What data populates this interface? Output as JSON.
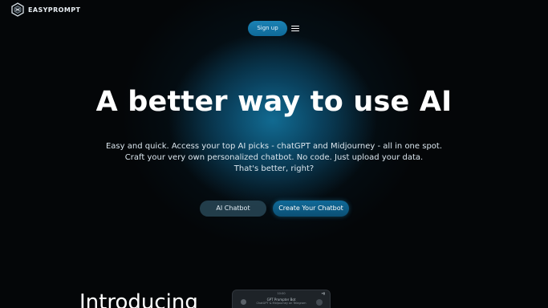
{
  "header": {
    "logo_text": "EASYPROMPT",
    "signup_label": "Sign up",
    "menu_icon": "hamburger-menu-icon"
  },
  "hero": {
    "title": "A better way to use AI",
    "subtitle_lines": [
      "Easy and quick. Access your top AI picks - chatGPT and Midjourney - all in one spot.",
      "Craft your very own personalized chatbot. No code. Just upload your data.",
      "That's better, right?"
    ],
    "buttons": {
      "ai_chatbot": "AI Chatbot",
      "create_chatbot": "Create Your Chatbot"
    }
  },
  "teaser": {
    "heading": "Introducing",
    "phone": {
      "status_time": "10:00",
      "status_icons": "▾▮",
      "title": "GPT Prompter Bot",
      "subtitle": "ChatGPT & Midjourney on Telegram"
    }
  },
  "colors": {
    "background": "#040608",
    "glow": "#126e96",
    "accent": "#1b82b4",
    "secondary_button": "#28465a"
  }
}
